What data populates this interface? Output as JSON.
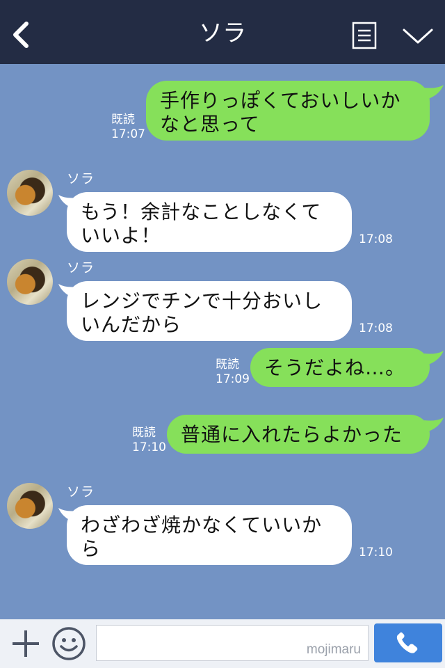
{
  "header": {
    "title": "ソラ"
  },
  "colors": {
    "header_bg": "#232c44",
    "chat_bg": "#7393c4",
    "outgoing_bubble": "#86e05a",
    "incoming_bubble": "#ffffff",
    "call_button": "#3f83dc"
  },
  "icons": [
    "back-icon",
    "menu-icon",
    "chevron-down-icon",
    "plus-icon",
    "smile-icon",
    "phone-icon"
  ],
  "messages": [
    {
      "dir": "out",
      "lines": [
        "手作りっぽくておいしいか",
        "なと思って"
      ],
      "read": "既読",
      "time": "17:07"
    },
    {
      "dir": "in",
      "sender": "ソラ",
      "lines": [
        "もう！余計なことしなくて",
        "いいよ！"
      ],
      "time": "17:08"
    },
    {
      "dir": "in",
      "sender": "ソラ",
      "lines": [
        "レンジでチンで十分おいし",
        "いんだから"
      ],
      "time": "17:08"
    },
    {
      "dir": "out",
      "lines": [
        "そうだよね…。"
      ],
      "read": "既読",
      "time": "17:09"
    },
    {
      "dir": "out",
      "lines": [
        "普通に入れたらよかった"
      ],
      "read": "既読",
      "time": "17:10"
    },
    {
      "dir": "in",
      "sender": "ソラ",
      "lines": [
        "わざわざ焼かなくていいか",
        "ら"
      ],
      "time": "17:10"
    }
  ],
  "composer": {
    "value": "",
    "watermark": "mojimaru"
  }
}
